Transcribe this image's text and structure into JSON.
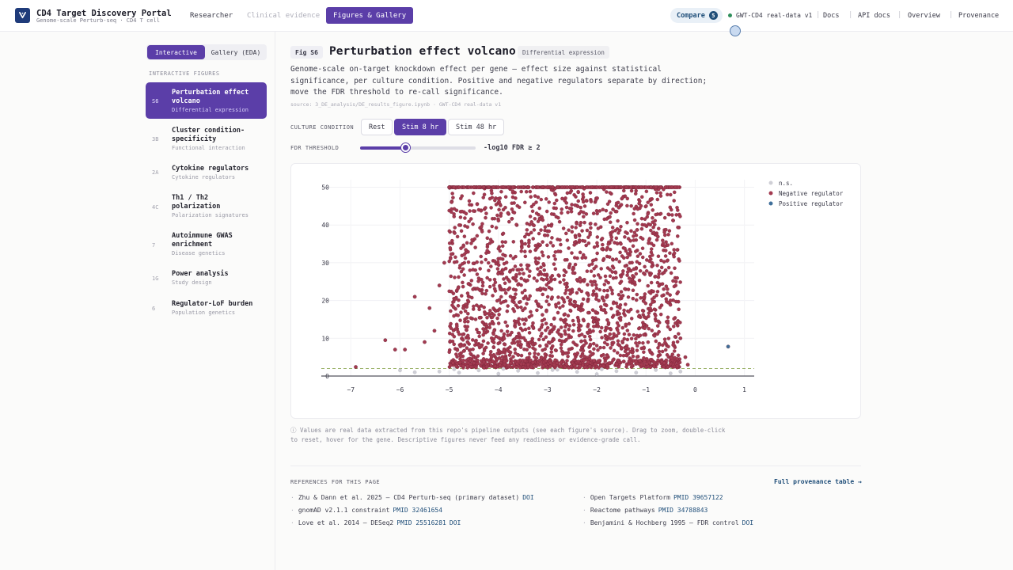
{
  "app": {
    "title": "CD4 Target Discovery Portal",
    "subtitle": "Genome-scale Perturb-seq · CD4 T cell",
    "logo_icon": "v-logo-icon"
  },
  "nav": {
    "tabs": [
      {
        "label": "Researcher",
        "state": "normal"
      },
      {
        "label": "Clinical evidence",
        "state": "disabled"
      },
      {
        "label": "Figures & Gallery",
        "state": "active"
      }
    ]
  },
  "topbar": {
    "compare_label": "Compare",
    "compare_count": "5",
    "dataset": "GWT-CD4 real-data v1",
    "links": [
      "Docs",
      "API docs",
      "Overview",
      "Provenance"
    ]
  },
  "sidebar": {
    "toggle": {
      "interactive": "Interactive",
      "gallery": "Gallery (EDA)"
    },
    "heading": "INTERACTIVE FIGURES",
    "items": [
      {
        "num": "S6",
        "title": "Perturbation effect volcano",
        "sub": "Differential expression",
        "active": true
      },
      {
        "num": "3B",
        "title": "Cluster condition-specificity",
        "sub": "Functional interaction",
        "active": false
      },
      {
        "num": "2A",
        "title": "Cytokine regulators",
        "sub": "Cytokine regulators",
        "active": false
      },
      {
        "num": "4C",
        "title": "Th1 / Th2 polarization",
        "sub": "Polarization signatures",
        "active": false
      },
      {
        "num": "7",
        "title": "Autoimmune GWAS enrichment",
        "sub": "Disease genetics",
        "active": false
      },
      {
        "num": "1G",
        "title": "Power analysis",
        "sub": "Study design",
        "active": false
      },
      {
        "num": "6",
        "title": "Regulator-LoF burden",
        "sub": "Population genetics",
        "active": false
      }
    ]
  },
  "main": {
    "fig_badge": "Fig S6",
    "title": "Perturbation effect volcano",
    "category": "Differential expression",
    "description": "Genome-scale on-target knockdown effect per gene — effect size against statistical significance, per culture condition. Positive and negative regulators separate by direction; move the FDR threshold to re-call significance.",
    "source": "source: 3_DE_analysis/DE_results_figure.ipynb · GWT-CD4 real-data v1",
    "culture_label": "CULTURE CONDITION",
    "conditions": [
      {
        "label": "Rest",
        "active": false
      },
      {
        "label": "Stim 8 hr",
        "active": true
      },
      {
        "label": "Stim 48 hr",
        "active": false
      }
    ],
    "fdr_label": "FDR THRESHOLD",
    "fdr_readout": "-log10 FDR ≥ 2",
    "fdr_value": 2,
    "fdr_slider_fraction": 0.4,
    "footnote": "ⓘ Values are real data extracted from this repo's pipeline outputs (see each figure's source). Drag to zoom, double-click to reset, hover for the gene. Descriptive figures never feed any readiness or evidence-grade call.",
    "refs_heading": "REFERENCES FOR THIS PAGE",
    "refs_link": "Full provenance table →",
    "references": [
      {
        "text": "Zhu & Dann et al. 2025 — CD4 Perturb-seq (primary dataset)",
        "tags": [
          "DOI"
        ]
      },
      {
        "text": "gnomAD v2.1.1 constraint",
        "tags": [
          "PMID 32461654"
        ]
      },
      {
        "text": "Love et al. 2014 — DESeq2",
        "tags": [
          "PMID 25516281",
          "DOI"
        ]
      },
      {
        "text": "Open Targets Platform",
        "tags": [
          "PMID 39657122"
        ]
      },
      {
        "text": "Reactome pathways",
        "tags": [
          "PMID 34788843"
        ]
      },
      {
        "text": "Benjamini & Hochberg 1995 — FDR control",
        "tags": [
          "DOI"
        ]
      }
    ]
  },
  "colors": {
    "accent": "#5b3ea8",
    "negative": "#a33a50",
    "positive": "#3f6f9a",
    "ns": "#cfcfd6",
    "threshold": "#9bb36a"
  },
  "chart_data": {
    "type": "scatter",
    "title": "",
    "xlabel": "",
    "ylabel": "",
    "xlim": [
      -7.6,
      1.2
    ],
    "ylim": [
      0,
      52
    ],
    "xticks": [
      -7,
      -6,
      -5,
      -4,
      -3,
      -2,
      -1,
      0,
      1
    ],
    "yticks": [
      0,
      10,
      20,
      30,
      40,
      50
    ],
    "grid": true,
    "threshold_y": 2,
    "legend_position": "top-right",
    "series": [
      {
        "name": "n.s.",
        "color": "#cfcfd6",
        "points": [
          [
            -5.2,
            1.2
          ],
          [
            -4.8,
            0.9
          ],
          [
            -4.4,
            1.5
          ],
          [
            -4.0,
            0.6
          ],
          [
            -3.6,
            1.4
          ],
          [
            -3.2,
            0.8
          ],
          [
            -2.8,
            1.7
          ],
          [
            -2.4,
            1.1
          ],
          [
            -2.0,
            0.5
          ],
          [
            -1.6,
            1.3
          ],
          [
            -1.2,
            0.9
          ],
          [
            -0.8,
            1.6
          ],
          [
            -0.5,
            0.7
          ],
          [
            -0.3,
            1.2
          ],
          [
            -4.9,
            1.8
          ],
          [
            -3.9,
            1.9
          ],
          [
            -2.9,
            1.6
          ],
          [
            -1.9,
            1.8
          ],
          [
            -5.7,
            1.0
          ],
          [
            -6.0,
            1.5
          ]
        ]
      },
      {
        "name": "Negative regulator",
        "color": "#a33a50",
        "points": [
          [
            -6.9,
            2.4
          ],
          [
            -6.3,
            9.5
          ],
          [
            -6.1,
            7
          ],
          [
            -5.9,
            7
          ],
          [
            -5.7,
            21
          ],
          [
            -5.5,
            9
          ],
          [
            -5.4,
            18
          ],
          [
            -5.3,
            12
          ],
          [
            -5.2,
            24
          ],
          [
            -5.1,
            30
          ],
          [
            -5.0,
            50
          ],
          [
            -4.9,
            50
          ],
          [
            -4.8,
            50
          ],
          [
            -4.7,
            50
          ],
          [
            -4.6,
            50
          ],
          [
            -4.5,
            50
          ],
          [
            -4.4,
            50
          ],
          [
            -4.3,
            50
          ],
          [
            -4.2,
            50
          ],
          [
            -4.1,
            50
          ],
          [
            -4.0,
            50
          ],
          [
            -3.9,
            50
          ],
          [
            -3.8,
            50
          ],
          [
            -3.7,
            50
          ],
          [
            -3.6,
            50
          ],
          [
            -3.5,
            50
          ],
          [
            -3.4,
            50
          ],
          [
            -3.3,
            50
          ],
          [
            -3.2,
            50
          ],
          [
            -3.1,
            50
          ],
          [
            -3.0,
            50
          ],
          [
            -2.9,
            50
          ],
          [
            -2.8,
            50
          ],
          [
            -2.7,
            50
          ],
          [
            -2.6,
            50
          ],
          [
            -2.5,
            50
          ],
          [
            -2.4,
            50
          ],
          [
            -2.3,
            50
          ],
          [
            -2.2,
            50
          ],
          [
            -2.1,
            50
          ],
          [
            -2.0,
            50
          ],
          [
            -1.9,
            50
          ],
          [
            -1.8,
            50
          ],
          [
            -1.7,
            50
          ],
          [
            -1.6,
            50
          ],
          [
            -1.5,
            50
          ],
          [
            -1.4,
            50
          ],
          [
            -1.3,
            50
          ],
          [
            -1.2,
            50
          ],
          [
            -1.1,
            50
          ],
          [
            -1.0,
            50
          ],
          [
            -0.9,
            50
          ],
          [
            -0.8,
            50
          ],
          [
            -0.7,
            50
          ],
          [
            -0.6,
            28
          ],
          [
            -0.5,
            20
          ],
          [
            -0.4,
            14
          ],
          [
            -0.3,
            10
          ],
          [
            -0.2,
            5
          ],
          [
            -0.15,
            3
          ]
        ]
      },
      {
        "name": "Positive regulator",
        "color": "#3f6f9a",
        "points": [
          [
            0.67,
            7.8
          ]
        ]
      }
    ]
  }
}
